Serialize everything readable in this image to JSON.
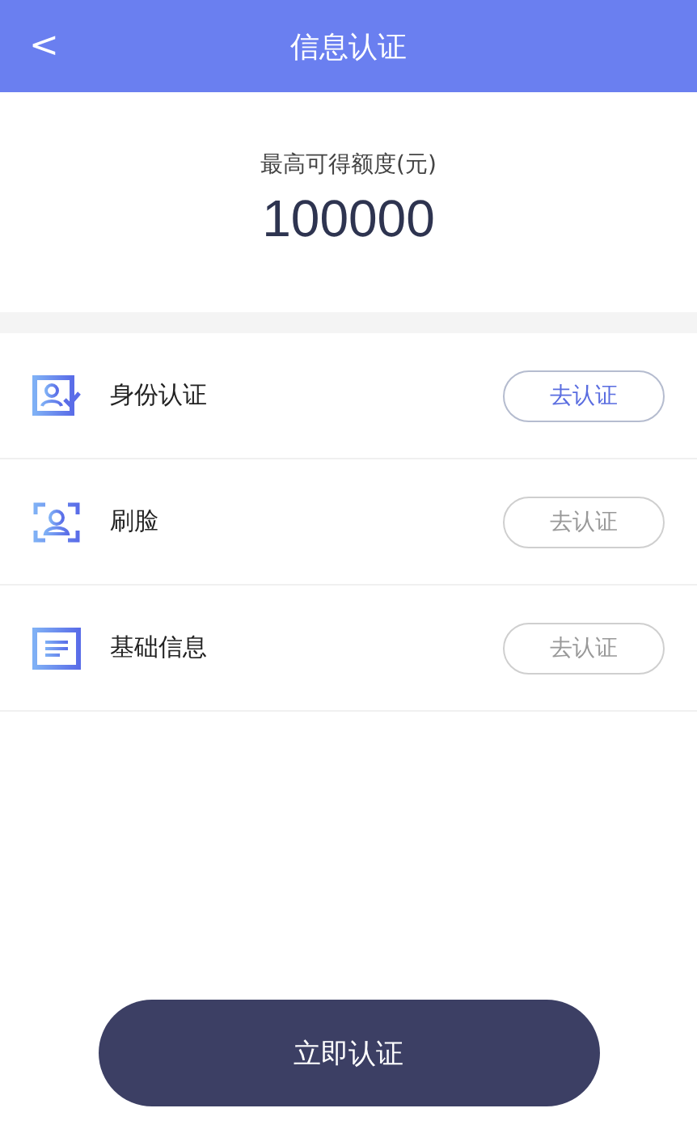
{
  "header": {
    "back": "<",
    "title": "信息认证"
  },
  "quota": {
    "label": "最高可得额度(元)",
    "amount": "100000"
  },
  "items": [
    {
      "kind": "id",
      "label": "身份认证",
      "action": "去认证",
      "enabled": true
    },
    {
      "kind": "face",
      "label": "刷脸",
      "action": "去认证",
      "enabled": false
    },
    {
      "kind": "info",
      "label": "基础信息",
      "action": "去认证",
      "enabled": false
    }
  ],
  "submit": "立即认证"
}
